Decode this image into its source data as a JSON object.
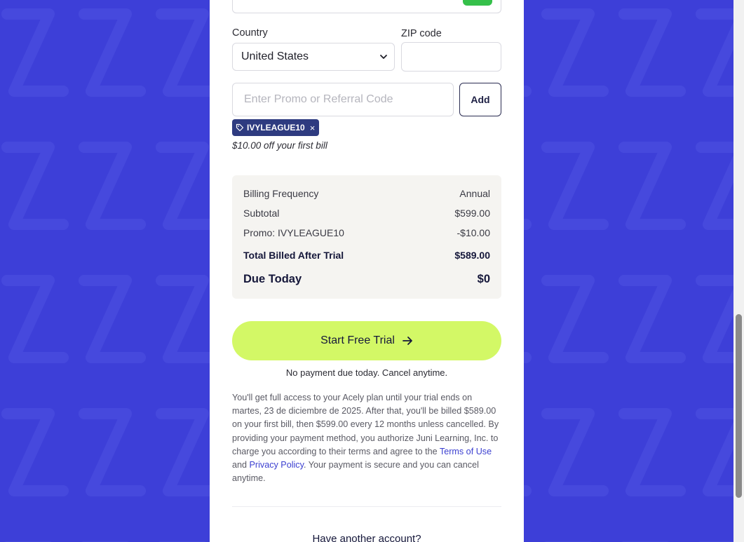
{
  "form": {
    "country_label": "Country",
    "country_value": "United States",
    "zip_label": "ZIP code",
    "zip_value": "",
    "promo_placeholder": "Enter Promo or Referral Code",
    "add_button": "Add",
    "applied_code": "IVYLEAGUE10",
    "discount_note": "$10.00 off your first bill"
  },
  "summary": {
    "rows": [
      {
        "label": "Billing Frequency",
        "value": "Annual"
      },
      {
        "label": "Subtotal",
        "value": "$599.00"
      },
      {
        "label": "Promo: IVYLEAGUE10",
        "value": "-$10.00"
      }
    ],
    "total_label": "Total Billed After Trial",
    "total_value": "$589.00",
    "due_label": "Due Today",
    "due_value": "$0"
  },
  "cta": {
    "label": "Start Free Trial",
    "subtext": "No payment due today. Cancel anytime."
  },
  "legal": {
    "text_before": "You'll get full access to your Acely plan until your trial ends on martes, 23 de diciembre de 2025. After that, you'll be billed $589.00 on your first bill, then $599.00 every 12 months unless cancelled. By providing your payment method, you authorize Juni Learning, Inc. to charge you according to their terms and agree to the ",
    "terms_link": "Terms of Use",
    "and_text": " and ",
    "privacy_link": "Privacy Policy",
    "text_after": ". Your payment is secure and you can cancel anytime."
  },
  "footer": {
    "another_account": "Have another account?"
  },
  "colors": {
    "background": "#3d3fd8",
    "cta": "#d3f866",
    "chip": "#2e3b80",
    "link": "#3b3fd0"
  }
}
